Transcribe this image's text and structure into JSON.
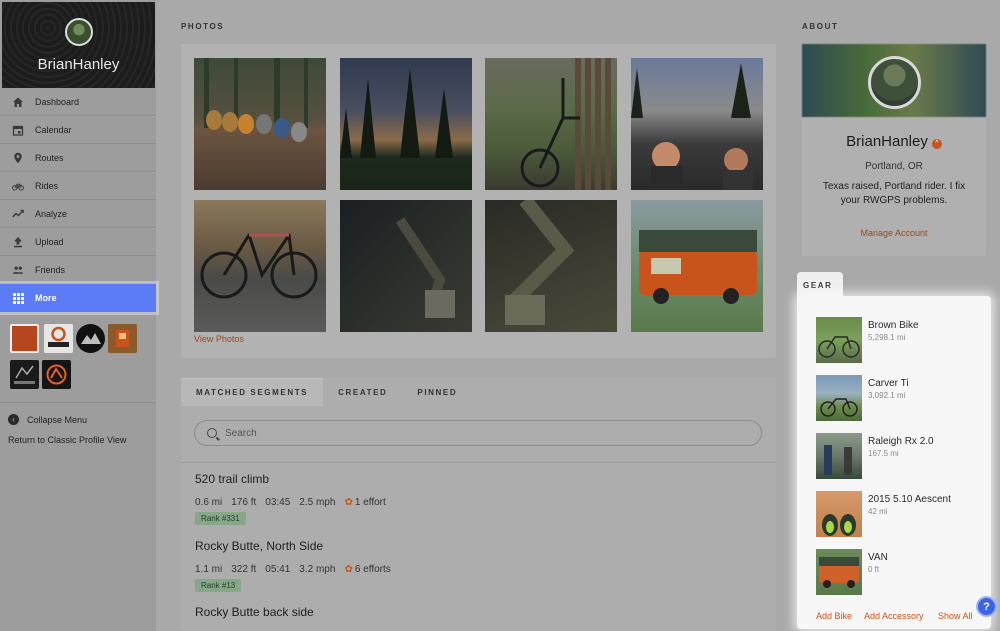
{
  "sidebar": {
    "username": "BrianHanley",
    "items": [
      {
        "label": "Dashboard",
        "icon": "home-icon"
      },
      {
        "label": "Calendar",
        "icon": "calendar-icon"
      },
      {
        "label": "Routes",
        "icon": "map-pin-icon"
      },
      {
        "label": "Rides",
        "icon": "bike-icon"
      },
      {
        "label": "Analyze",
        "icon": "trend-icon"
      },
      {
        "label": "Upload",
        "icon": "upload-icon"
      },
      {
        "label": "Friends",
        "icon": "people-icon"
      },
      {
        "label": "More",
        "icon": "grid-icon"
      }
    ],
    "active_item": "More",
    "collapse_label": "Collapse Menu",
    "classic_label": "Return to Classic Profile View"
  },
  "photos": {
    "title": "PHOTOS",
    "view_link": "View Photos"
  },
  "segments": {
    "tabs": [
      "MATCHED SEGMENTS",
      "CREATED",
      "PINNED"
    ],
    "active_tab": "MATCHED SEGMENTS",
    "search_placeholder": "Search",
    "items": [
      {
        "name": "520 trail climb",
        "distance": "0.6 mi",
        "elevation": "176 ft",
        "time": "03:45",
        "speed": "2.5 mph",
        "efforts": "1 effort",
        "rank": "Rank #331"
      },
      {
        "name": "Rocky Butte, North Side",
        "distance": "1.1 mi",
        "elevation": "322 ft",
        "time": "05:41",
        "speed": "3.2 mph",
        "efforts": "6 efforts",
        "rank": "Rank #13"
      },
      {
        "name": "Rocky Butte back side"
      }
    ]
  },
  "about": {
    "title": "ABOUT",
    "name": "BrianHanley",
    "location": "Portland, OR",
    "bio": "Texas raised, Portland rider. I fix your RWGPS problems.",
    "manage_link": "Manage Account"
  },
  "gear": {
    "title": "GEAR",
    "items": [
      {
        "name": "Brown Bike",
        "distance": "5,298.1 mi"
      },
      {
        "name": "Carver Ti",
        "distance": "3,092.1 mi"
      },
      {
        "name": "Raleigh Rx 2.0",
        "distance": "167.5 mi"
      },
      {
        "name": "2015 5.10 Aescent",
        "distance": "42 mi"
      },
      {
        "name": "VAN",
        "distance": "0 ft"
      }
    ],
    "add_bike": "Add Bike",
    "add_accessory": "Add Accessory",
    "show_all": "Show All"
  },
  "colors": {
    "accent_blue": "#5b7cf6",
    "link_orange": "#c9541b",
    "rank_green": "#86a889"
  }
}
